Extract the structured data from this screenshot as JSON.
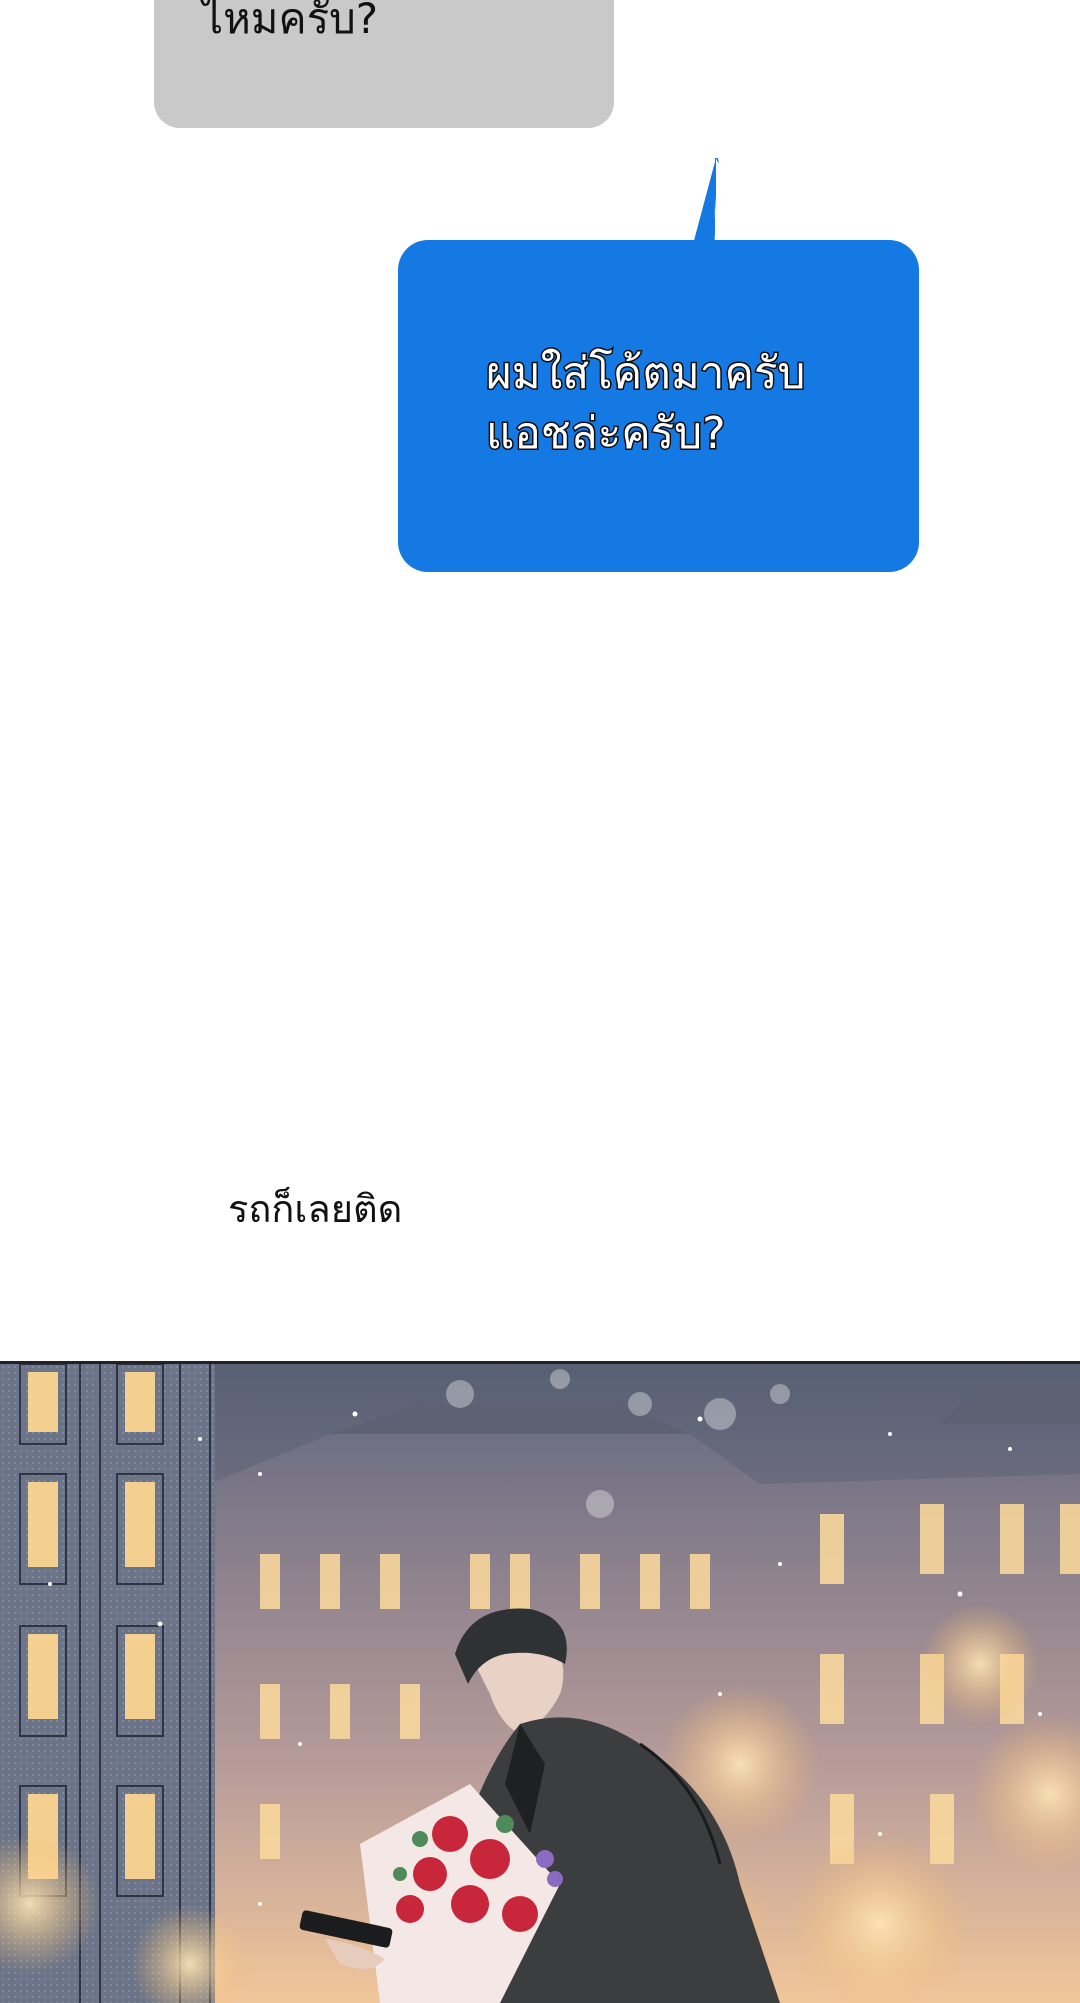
{
  "bubbles": {
    "gray_text": "ไหมครับ?",
    "blue_text_line1": "ผมใส่โค้ตมาครับ",
    "blue_text_line2": "แอชล่ะครับ?"
  },
  "narration": "รถก็เลยติด",
  "colors": {
    "gray_bubble": "#c9c9c9",
    "blue_bubble": "#1579e3",
    "sky": "#5c6476",
    "bokeh": "#f7c98a"
  },
  "panel": {
    "scene": "man-with-bouquet-and-phone-night-street-icon"
  }
}
